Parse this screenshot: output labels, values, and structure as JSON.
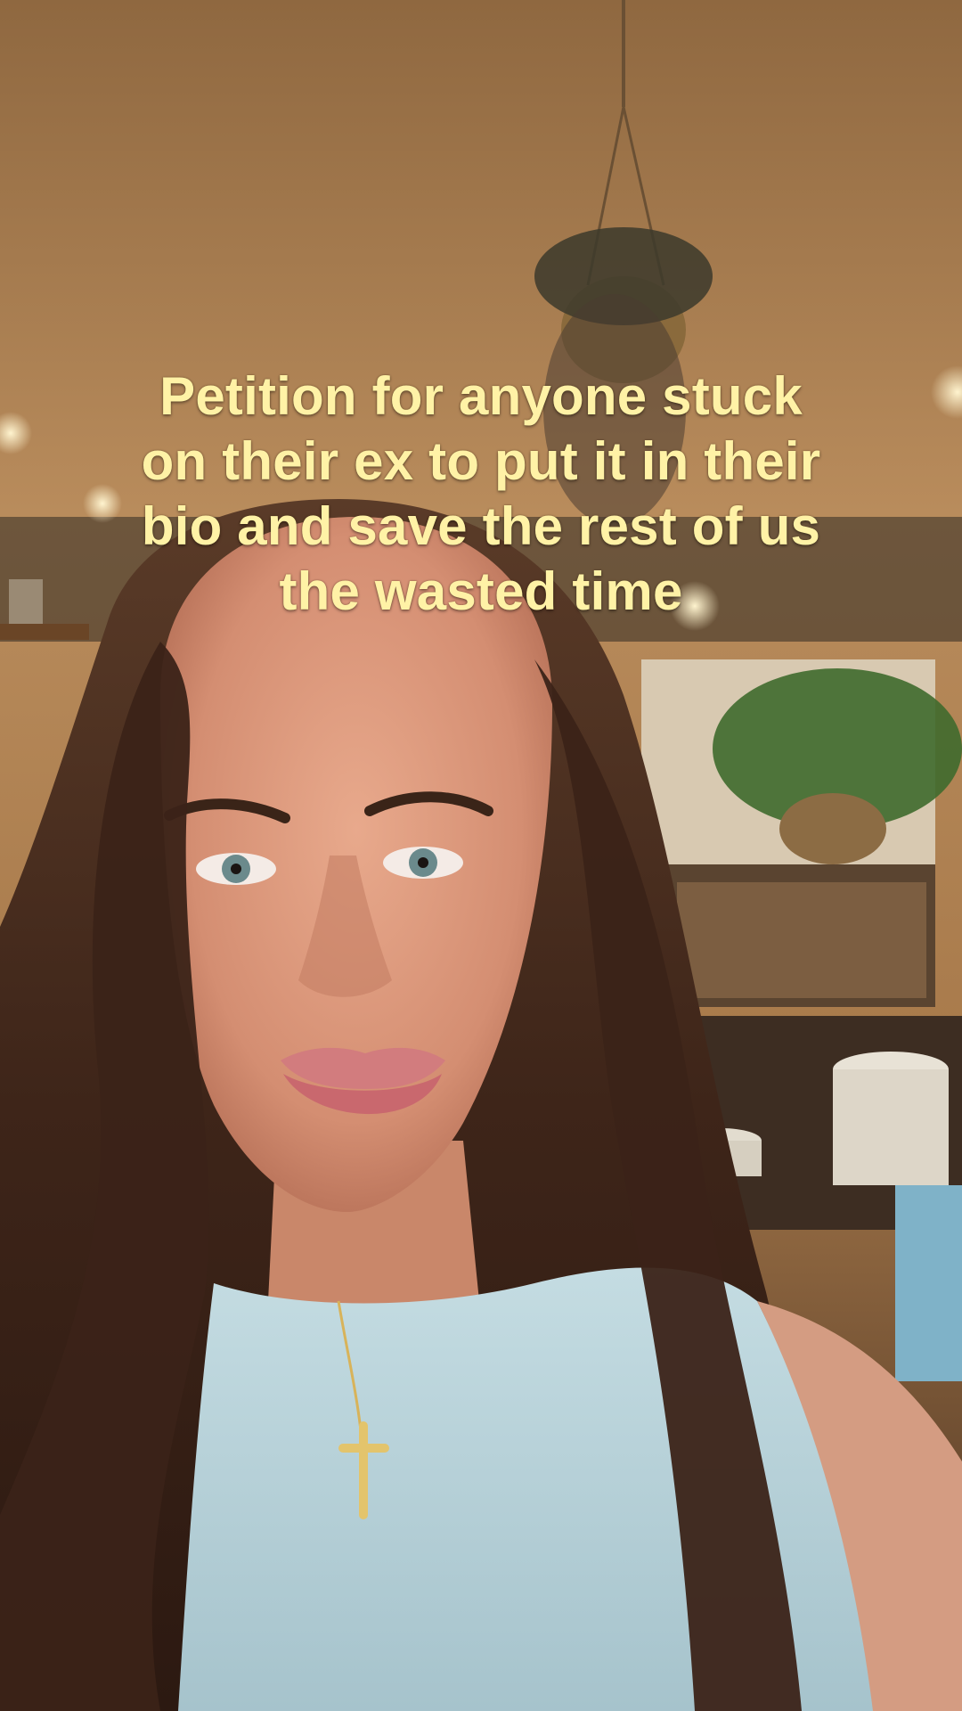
{
  "overlay": {
    "caption_lines": [
      "Petition for anyone stuck",
      "on their ex to put it in their",
      "bio and save the rest of us",
      "the wasted time"
    ],
    "caption_color": "#fff2a6"
  },
  "scene": {
    "description_colors": {
      "ceiling": "#b8895a",
      "hair": "#4a2c1c",
      "skin": "#d9987c",
      "top": "#b8d4dc"
    }
  }
}
